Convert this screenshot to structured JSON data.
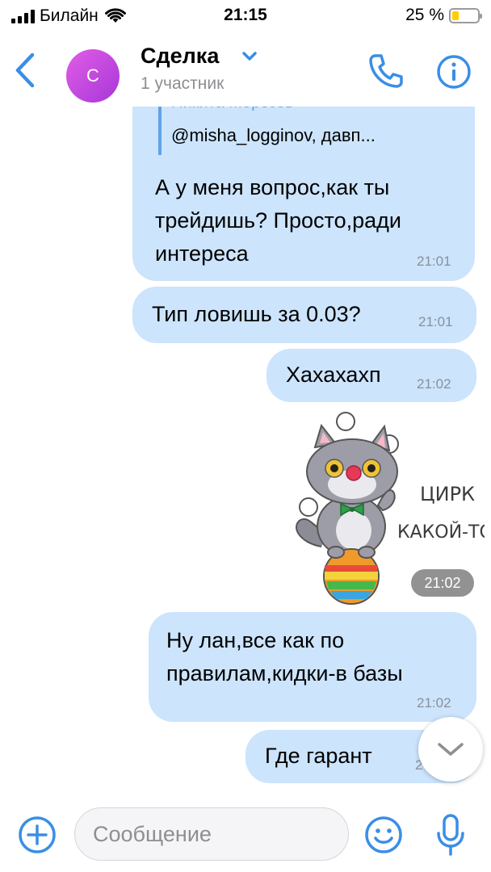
{
  "status_bar": {
    "carrier": "Билайн",
    "time": "21:15",
    "battery": "25 %",
    "battery_level": 0.25
  },
  "header": {
    "avatar_letter": "С",
    "title": "Сделка",
    "subtitle": "1 участник"
  },
  "messages": [
    {
      "reply_author": "Никита Морозов",
      "reply_preview": "@misha_logginov, давп...",
      "lines": [
        "А у меня вопрос,как ты",
        "трейдишь? Просто,ради",
        "интереса"
      ],
      "time": "21:01"
    },
    {
      "lines": [
        "Тип ловишь за 0.03?"
      ],
      "time": "21:01"
    },
    {
      "lines": [
        "Хахахахп"
      ],
      "time": "21:02"
    },
    {
      "sticker_time": "21:02"
    },
    {
      "lines": [
        "Ну лан,все как по",
        "правилам,кидки-в базы"
      ],
      "time": "21:02"
    },
    {
      "lines": [
        "Где гарант"
      ],
      "time": "2"
    }
  ],
  "sticker": {
    "caption_line1": "ЦИРК",
    "caption_line2": "КАКОЙ-ТО"
  },
  "composer": {
    "placeholder": "Сообщение"
  },
  "colors": {
    "accent": "#3a8ee6",
    "bubble": "#cce4fc",
    "avatar": "#c84ae0"
  },
  "icons": [
    "back-chevron-icon",
    "chevron-down-icon",
    "phone-icon",
    "info-icon",
    "scroll-down-icon",
    "add-icon",
    "emoji-icon",
    "microphone-icon"
  ]
}
